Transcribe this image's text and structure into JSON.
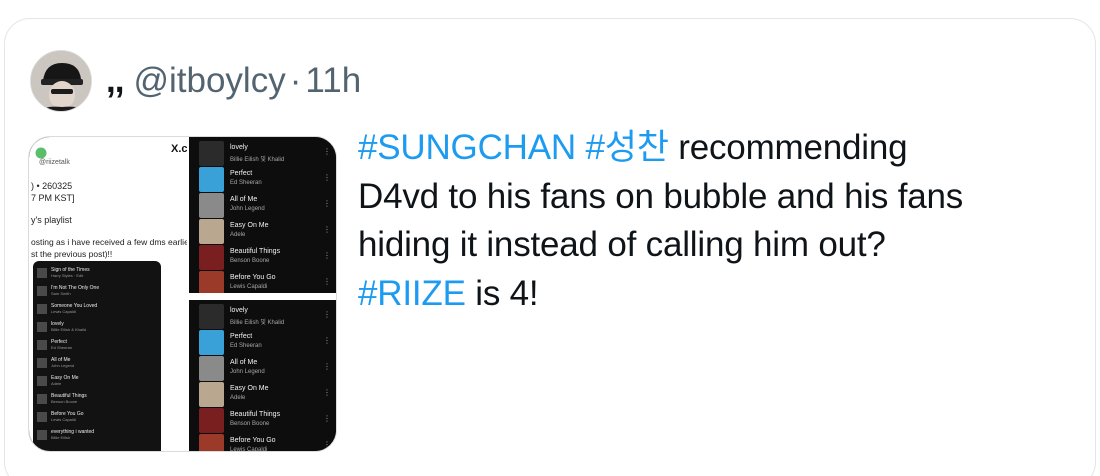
{
  "author": {
    "display_name": ",,",
    "handle": "@itboylcy",
    "separator": "·",
    "time": "11h"
  },
  "tweet": {
    "lines": [
      [
        {
          "text": "#SUNGCHAN",
          "tag": true
        },
        {
          "text": " ",
          "tag": false
        },
        {
          "text": "#성찬",
          "tag": true
        },
        {
          "text": " recommending",
          "tag": false
        }
      ],
      [
        {
          "text": "D4vd to his fans on bubble and his fans",
          "tag": false
        }
      ],
      [
        {
          "text": "hiding it instead of calling him out?",
          "tag": false
        }
      ],
      [
        {
          "text": "#RIIZE",
          "tag": true
        },
        {
          "text": " is 4!",
          "tag": false
        }
      ]
    ]
  },
  "media": {
    "left_screenshot": {
      "brand": "X.co",
      "account": "@riizetalk",
      "date_line": ") • 260325",
      "time_line": "7 PM KST]",
      "subtitle": "y's playlist",
      "body_line1": "osting as i have received a few dms earlie",
      "body_line2": "st the previous post)!!",
      "songs": [
        {
          "title": "Sign of the Times",
          "artist": "Harry Styles · Edit"
        },
        {
          "title": "I'm Not The Only One",
          "artist": "Sam Smith"
        },
        {
          "title": "Someone You Loved",
          "artist": "Lewis Capaldi"
        },
        {
          "title": "lovely",
          "artist": "Billie Eilish & Khalid"
        },
        {
          "title": "Perfect",
          "artist": "Ed Sheeran"
        },
        {
          "title": "All of Me",
          "artist": "John Legend"
        },
        {
          "title": "Easy On Me",
          "artist": "Adele"
        },
        {
          "title": "Beautiful Things",
          "artist": "Benson Boone"
        },
        {
          "title": "Before You Go",
          "artist": "Lewis Capaldi"
        },
        {
          "title": "everything i wanted",
          "artist": "Billie Eilish"
        }
      ]
    },
    "right_top_songs": [
      {
        "title": "lovely",
        "artist": "Billie Eilish 및 Khalid",
        "color": "#2b2b2b"
      },
      {
        "title": "Perfect",
        "artist": "Ed Sheeran",
        "color": "#3aa0d8"
      },
      {
        "title": "All of Me",
        "artist": "John Legend",
        "color": "#8a8a8a"
      },
      {
        "title": "Easy On Me",
        "artist": "Adele",
        "color": "#b9a88f"
      },
      {
        "title": "Beautiful Things",
        "artist": "Benson Boone",
        "color": "#7a1f1f"
      },
      {
        "title": "Before You Go",
        "artist": "Lewis Capaldi",
        "color": "#9c3a2a"
      }
    ],
    "right_bottom_songs": [
      {
        "title": "lovely",
        "artist": "Billie Eilish 및 Khalid",
        "color": "#2b2b2b"
      },
      {
        "title": "Perfect",
        "artist": "Ed Sheeran",
        "color": "#3aa0d8"
      },
      {
        "title": "All of Me",
        "artist": "John Legend",
        "color": "#8a8a8a"
      },
      {
        "title": "Easy On Me",
        "artist": "Adele",
        "color": "#b9a88f"
      },
      {
        "title": "Beautiful Things",
        "artist": "Benson Boone",
        "color": "#7a1f1f"
      },
      {
        "title": "Before You Go",
        "artist": "Lewis Capaldi",
        "color": "#9c3a2a"
      }
    ]
  },
  "colors": {
    "hashtag": "#1d9bf0",
    "text": "#0f1419",
    "muted": "#536471"
  }
}
